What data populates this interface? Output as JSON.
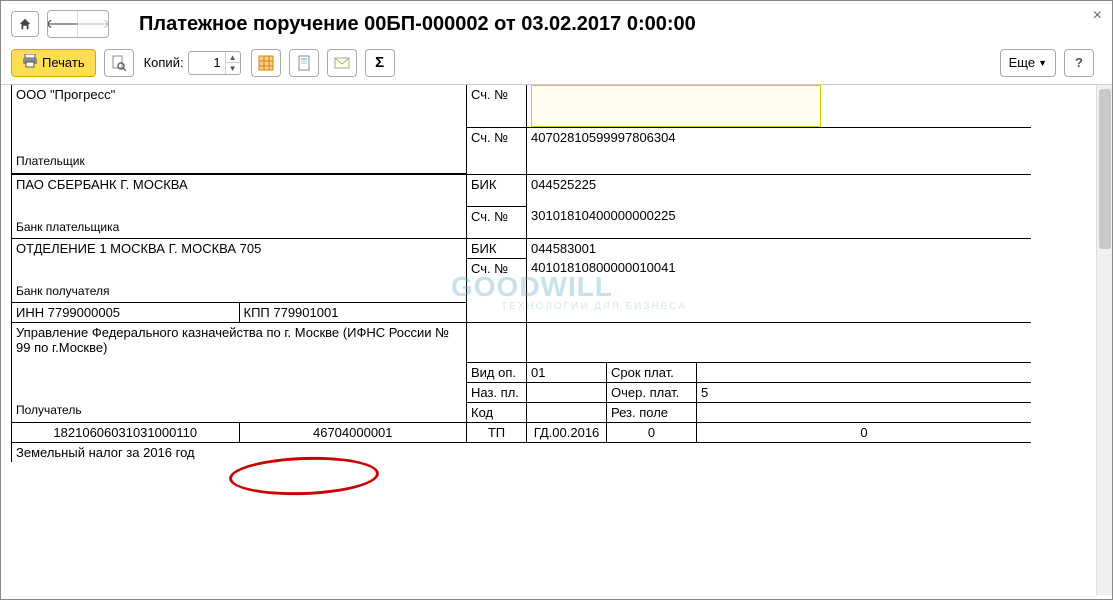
{
  "window": {
    "title": "Платежное поручение 00БП-000002 от 03.02.2017 0:00:00",
    "close": "×"
  },
  "toolbar": {
    "print": "Печать",
    "copies_label": "Копий:",
    "copies_value": "1",
    "more": "Еще"
  },
  "doc": {
    "payer_org": "ООО \"Прогресс\"",
    "payer_label": "Плательщик",
    "acc_label": "Сч. №",
    "payer_acc": "40702810599997806304",
    "payer_bank": "ПАО СБЕРБАНК Г. МОСКВА",
    "bik_label": "БИК",
    "payer_bik": "044525225",
    "payer_bank_acc": "30101810400000000225",
    "payer_bank_label": "Банк плательщика",
    "recip_bank": "ОТДЕЛЕНИЕ 1 МОСКВА Г. МОСКВА 705",
    "recip_bik": "044583001",
    "recip_bank_label": "Банк получателя",
    "recip_bank_acc": "40101810800000010041",
    "inn": "ИНН 7799000005",
    "kpp": "КПП 779901001",
    "recipient_text": "Управление Федерального казначейства по г. Москве (ИФНС России № 99 по г.Москве)",
    "recipient_label": "Получатель",
    "vid_op_label": "Вид оп.",
    "vid_op": "01",
    "srok_label": "Срок плат.",
    "naz_label": "Наз. пл.",
    "ocher_label": "Очер. плат.",
    "ocher": "5",
    "kod_label": "Код",
    "rez_label": "Рез. поле",
    "row": {
      "kbk": "18210606031031000110",
      "okato": "46704000001",
      "tp": "ТП",
      "period": "ГД.00.2016",
      "z1": "0",
      "z2": "0"
    },
    "purpose": "Земельный налог за 2016 год"
  },
  "watermark": {
    "main": "GOODWILL",
    "sub": "ТЕХНОЛОГИИ ДЛЯ БИЗНЕСА"
  }
}
